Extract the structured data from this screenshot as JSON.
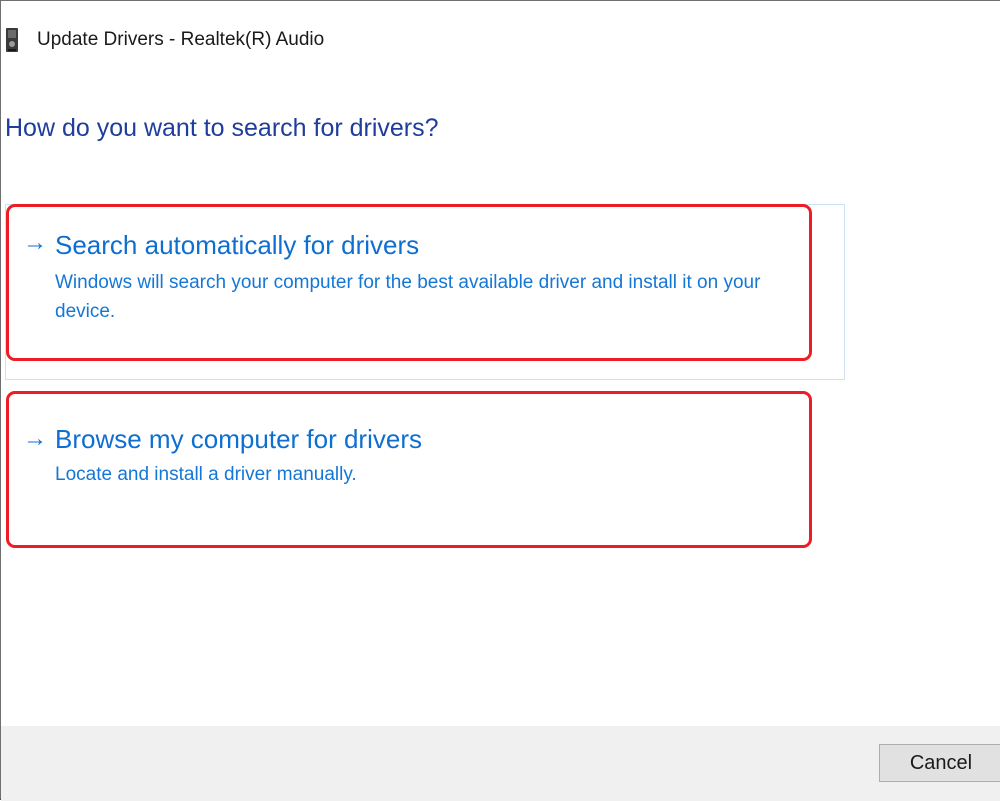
{
  "window": {
    "title": "Update Drivers - Realtek(R) Audio",
    "icon": "audio-device-icon"
  },
  "heading": "How do you want to search for drivers?",
  "options": [
    {
      "arrow": "→",
      "title": "Search automatically for drivers",
      "description": "Windows will search your computer for the best available driver and install it on your device."
    },
    {
      "arrow": "→",
      "title": "Browse my computer for drivers",
      "description": "Locate and install a driver manually."
    }
  ],
  "footer": {
    "cancel_label": "Cancel"
  },
  "colors": {
    "heading": "#1f3d9a",
    "link": "#0e6fd1",
    "highlight_border": "#ee1c25",
    "footer_bg": "#f0f0f0"
  }
}
